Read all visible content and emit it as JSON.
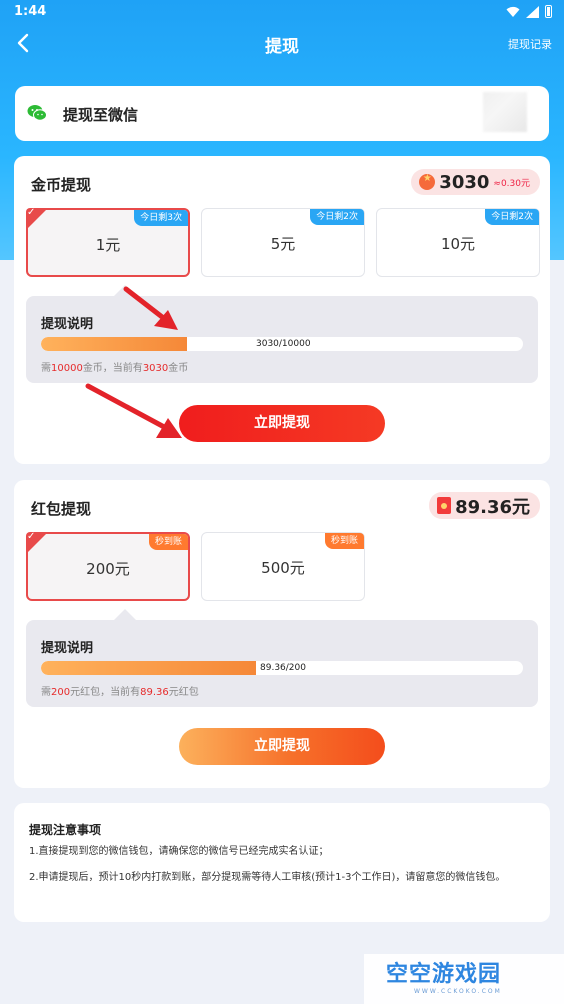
{
  "status": {
    "time": "1:44"
  },
  "nav": {
    "title": "提现",
    "history_link": "提现记录"
  },
  "wechat": {
    "label": "提现至微信"
  },
  "coin": {
    "title": "金币提现",
    "balance": "3030",
    "balance_sub": "≈0.30元",
    "options": [
      {
        "label": "1元",
        "tag": "今日剩3次",
        "selected": true
      },
      {
        "label": "5元",
        "tag": "今日剩2次",
        "selected": false
      },
      {
        "label": "10元",
        "tag": "今日剩2次",
        "selected": false
      }
    ],
    "desc_title": "提现说明",
    "progress_text": "3030/10000",
    "progress_fraction": 0.303,
    "note_prefix": "需",
    "note_need": "10000",
    "note_mid": "金币，当前有",
    "note_have": "3030",
    "note_suffix": "金币",
    "button": "立即提现"
  },
  "redpacket": {
    "title": "红包提现",
    "balance": "89.36元",
    "options": [
      {
        "label": "200元",
        "tag": "秒到账",
        "selected": true
      },
      {
        "label": "500元",
        "tag": "秒到账",
        "selected": false
      }
    ],
    "desc_title": "提现说明",
    "progress_text": "89.36/200",
    "progress_fraction": 0.4468,
    "note_prefix": "需",
    "note_need": "200",
    "note_mid": "元红包，当前有",
    "note_have": "89.36",
    "note_suffix": "元红包",
    "button": "立即提现"
  },
  "notes": {
    "title": "提现注意事项",
    "line1": "1.直接提现到您的微信钱包，请确保您的微信号已经完成实名认证；",
    "line2": "2.申请提现后，预计10秒内打款到账，部分提现需等待人工审核(预计1-3个工作日)，请留意您的微信钱包。"
  },
  "watermark": {
    "text": "空空游戏园",
    "sub": "WWW.CCKOKO.COM"
  },
  "colors": {
    "header_blue": "#2ab6ff",
    "accent_red": "#e84a4a",
    "progress_orange": "#f58838"
  }
}
